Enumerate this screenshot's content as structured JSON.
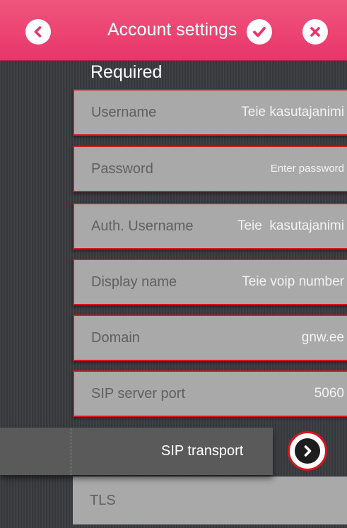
{
  "header": {
    "title": "Account settings"
  },
  "section": {
    "title": "Required"
  },
  "fields": [
    {
      "label": "Username",
      "value": "Teie kasutajanimi"
    },
    {
      "label": "Password",
      "value": "Enter password"
    },
    {
      "label": "Auth. Username",
      "value": "Teie  kasutajanimi"
    },
    {
      "label": "Display name",
      "value": "Teie voip number"
    },
    {
      "label": "Domain",
      "value": "gnw.ee"
    },
    {
      "label": "SIP server port",
      "value": "5060"
    }
  ],
  "transport": {
    "label": "SIP transport",
    "value": "TLS"
  },
  "icons": {
    "back": "chevron-left-icon",
    "done": "checkmark-icon",
    "close": "close-icon",
    "next": "chevron-right-icon"
  },
  "colors": {
    "accent": "#e8356a",
    "field_border": "#d8141f",
    "field_bg": "#a9a9a9",
    "background": "#3a3c40"
  }
}
